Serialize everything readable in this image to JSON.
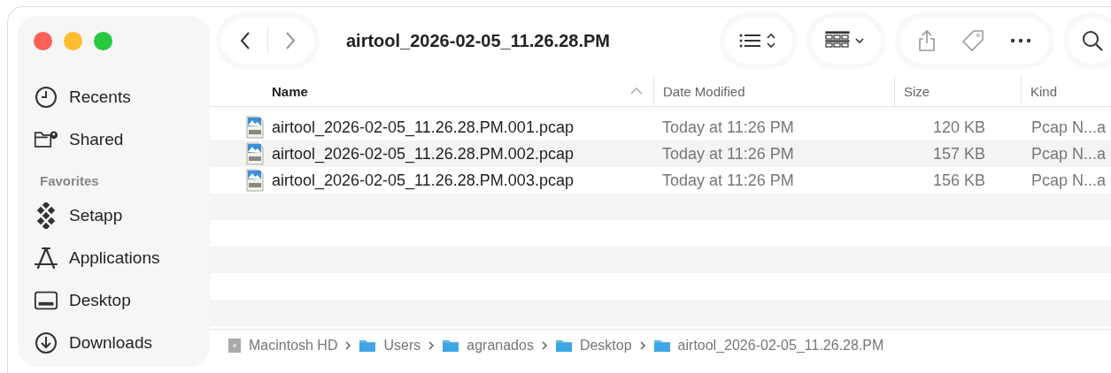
{
  "window": {
    "title": "airtool_2026-02-05_11.26.28.PM"
  },
  "sidebar": {
    "items": [
      {
        "kind": "item",
        "label": "Recents"
      },
      {
        "kind": "item",
        "label": "Shared"
      },
      {
        "kind": "heading",
        "label": "Favorites"
      },
      {
        "kind": "item",
        "label": "Setapp"
      },
      {
        "kind": "item",
        "label": "Applications"
      },
      {
        "kind": "item",
        "label": "Desktop"
      },
      {
        "kind": "item",
        "label": "Downloads"
      }
    ]
  },
  "table": {
    "columns": [
      {
        "label": "Name",
        "sorted": true
      },
      {
        "label": "Date Modified",
        "sorted": false
      },
      {
        "label": "Size",
        "sorted": false
      },
      {
        "label": "Kind",
        "sorted": false
      }
    ],
    "rows": [
      {
        "name": "airtool_2026-02-05_11.26.28.PM.001.pcap",
        "date": "Today at 11:26 PM",
        "size": "120 KB",
        "kind": "Pcap N...a"
      },
      {
        "name": "airtool_2026-02-05_11.26.28.PM.002.pcap",
        "date": "Today at 11:26 PM",
        "size": "157 KB",
        "kind": "Pcap N...a"
      },
      {
        "name": "airtool_2026-02-05_11.26.28.PM.003.pcap",
        "date": "Today at 11:26 PM",
        "size": "156 KB",
        "kind": "Pcap N...a"
      }
    ]
  },
  "path_bar": [
    {
      "label": "Macintosh HD",
      "kind": "disk"
    },
    {
      "label": "Users",
      "kind": "folder"
    },
    {
      "label": "agranados",
      "kind": "folder"
    },
    {
      "label": "Desktop",
      "kind": "folder"
    },
    {
      "label": "airtool_2026-02-05_11.26.28.PM",
      "kind": "folder"
    }
  ]
}
